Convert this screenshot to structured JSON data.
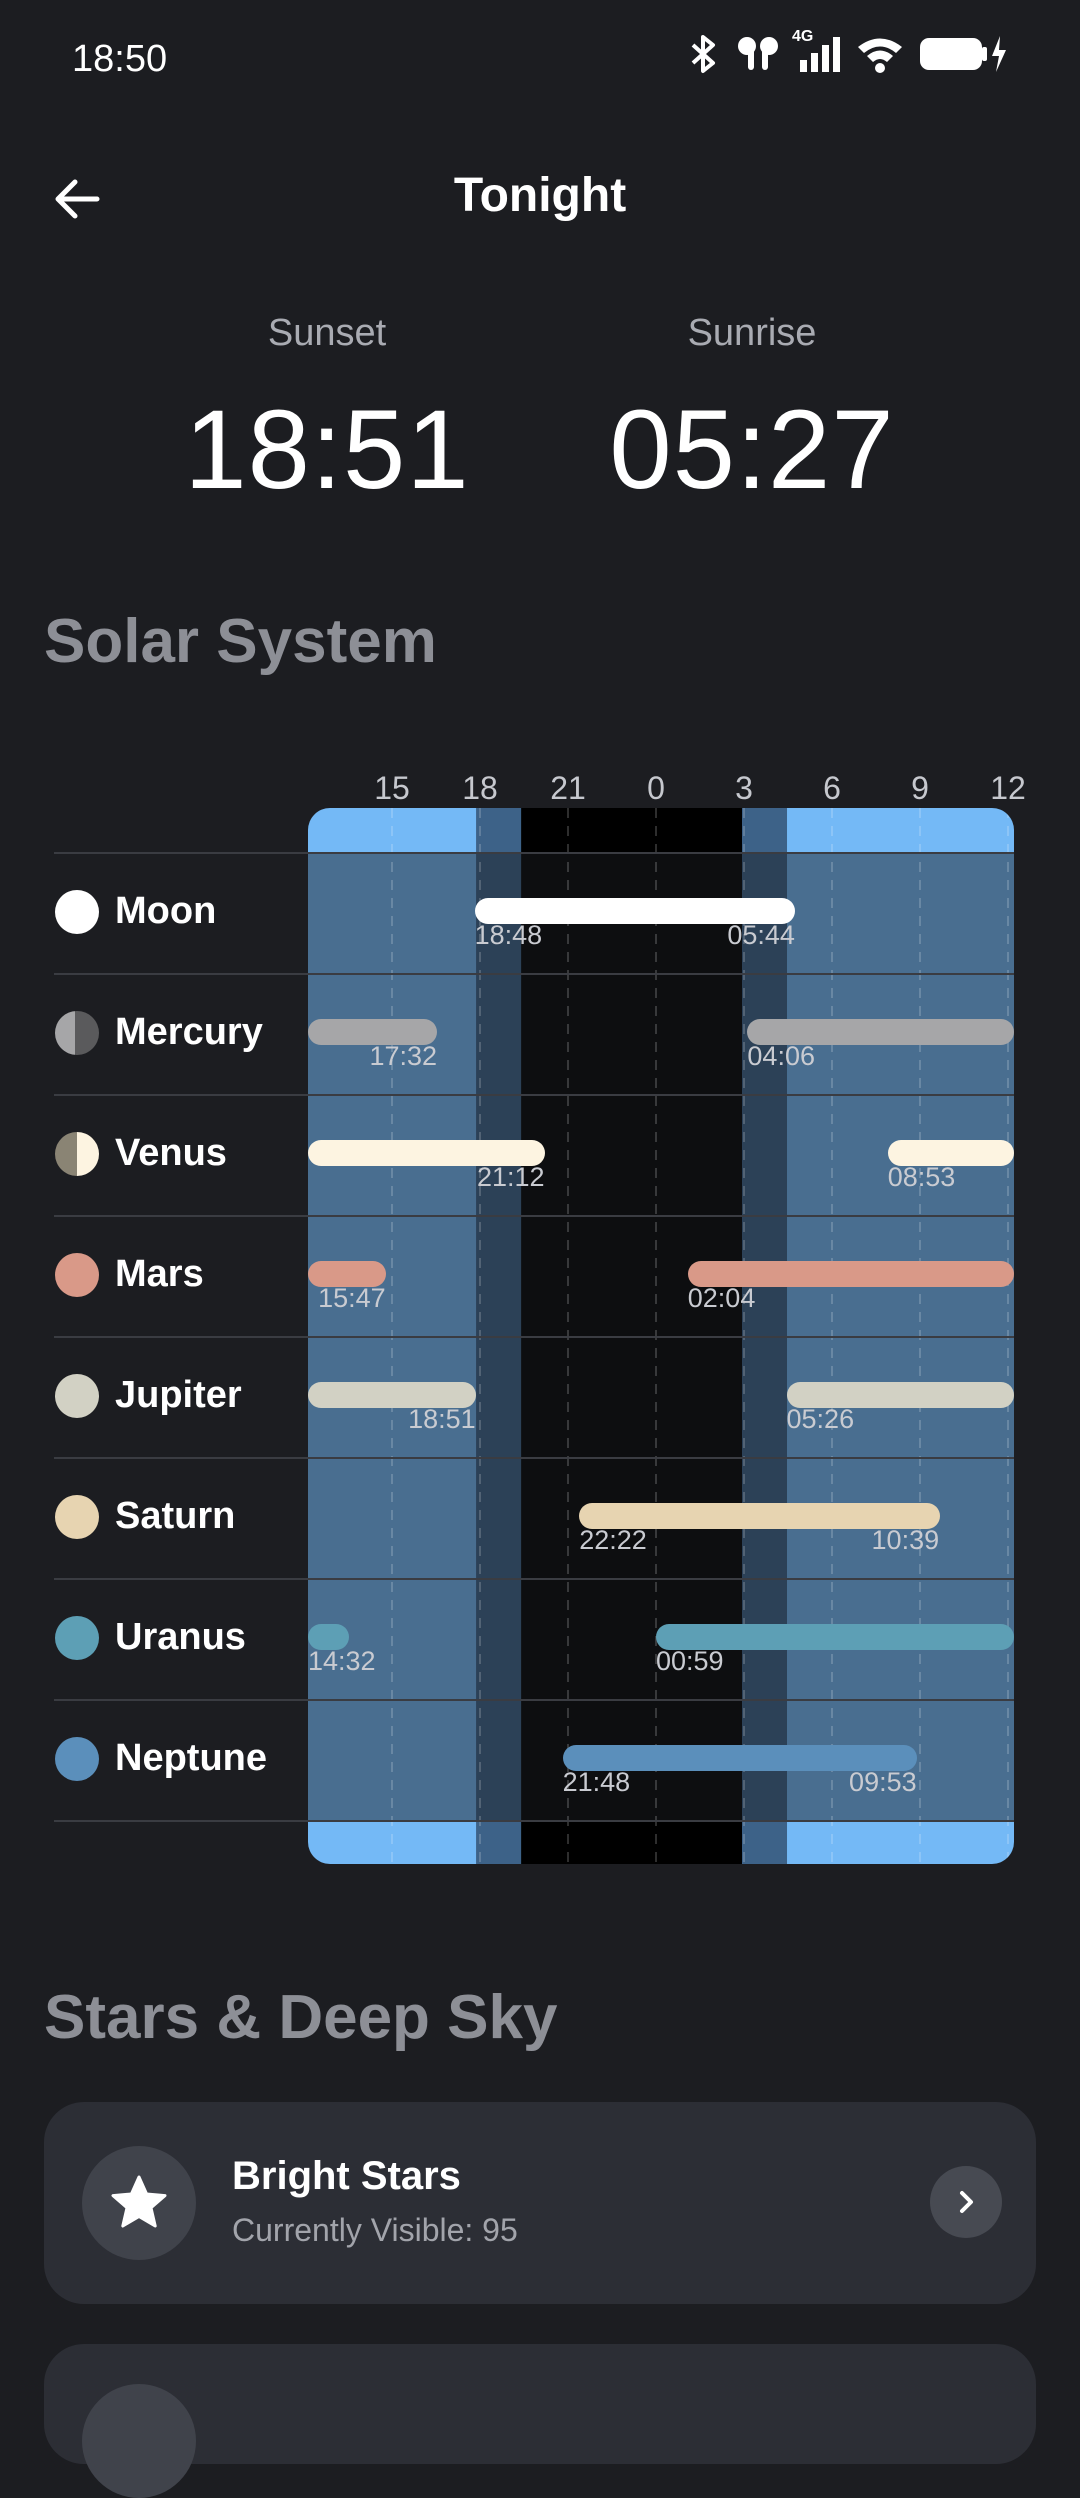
{
  "status_bar": {
    "time": "18:50",
    "network": "4G"
  },
  "header": {
    "title": "Tonight"
  },
  "sun": {
    "sunset_label": "Sunset",
    "sunset_time": "18:51",
    "sunrise_label": "Sunrise",
    "sunrise_time": "05:27"
  },
  "solar_system": {
    "title": "Solar System",
    "hours": [
      "15",
      "18",
      "21",
      "0",
      "3",
      "6",
      "9",
      "12"
    ],
    "bodies": [
      {
        "name": "Moon",
        "rise": "18:48",
        "set": "05:44",
        "color": "#ffffff"
      },
      {
        "name": "Mercury",
        "rise": "04:06",
        "set": "17:32",
        "color": "#a6a6a8"
      },
      {
        "name": "Venus",
        "rise": "08:53",
        "set": "21:12",
        "color": "#fdf4e1"
      },
      {
        "name": "Mars",
        "rise": "02:04",
        "set": "15:47",
        "color": "#d99988"
      },
      {
        "name": "Jupiter",
        "rise": "05:26",
        "set": "18:51",
        "color": "#d2d1c4"
      },
      {
        "name": "Saturn",
        "rise": "22:22",
        "set": "10:39",
        "color": "#e7d4b1"
      },
      {
        "name": "Uranus",
        "rise": "00:59",
        "set": "14:32",
        "color": "#5d9fb5"
      },
      {
        "name": "Neptune",
        "rise": "21:48",
        "set": "09:53",
        "color": "#5b8fbb"
      }
    ]
  },
  "deep_sky": {
    "title": "Stars & Deep Sky",
    "cards": [
      {
        "title": "Bright Stars",
        "subtitle": "Currently Visible: 95",
        "icon": "star-icon"
      }
    ]
  },
  "colors": {
    "background": "#1c1d21",
    "day": "#74b9f6",
    "twilight": "#3d6288",
    "night": "#000000",
    "card": "#2c2e35"
  }
}
